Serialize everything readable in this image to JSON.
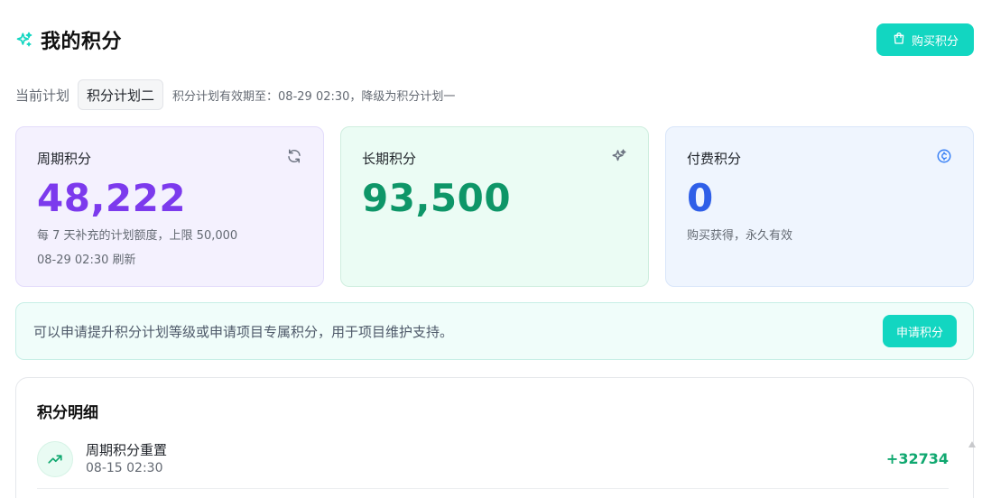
{
  "header": {
    "title": "我的积分",
    "title_icon": "sparkle-icon",
    "buy_button": "购买积分",
    "buy_icon": "shopping-bag-icon"
  },
  "plan": {
    "label": "当前计划",
    "name": "积分计划二",
    "note": "积分计划有效期至：08-29 02:30，降级为积分计划一"
  },
  "cards": [
    {
      "title": "周期积分",
      "icon": "refresh-icon",
      "value": "48,222",
      "desc": "每 7 天补充的计划额度，上限 50,000",
      "desc2": "08-29 02:30 刷新",
      "color": "#7c3aed"
    },
    {
      "title": "长期积分",
      "icon": "sparkle-icon",
      "value": "93,500",
      "color": "#0e9668"
    },
    {
      "title": "付费积分",
      "icon": "coin-icon",
      "value": "0",
      "desc": "购买获得，永久有效",
      "color": "#2f5fe8"
    }
  ],
  "banner": {
    "text": "可以申请提升积分计划等级或申请项目专属积分，用于项目维护支持。",
    "button": "申请积分"
  },
  "detail": {
    "title": "积分明细",
    "rows": [
      {
        "title": "周期积分重置",
        "time": "08-15 02:30",
        "amount": "+32734",
        "icon": "trending-up-icon"
      }
    ]
  },
  "colors": {
    "accent": "#12d6c1",
    "positive": "#10a870"
  }
}
